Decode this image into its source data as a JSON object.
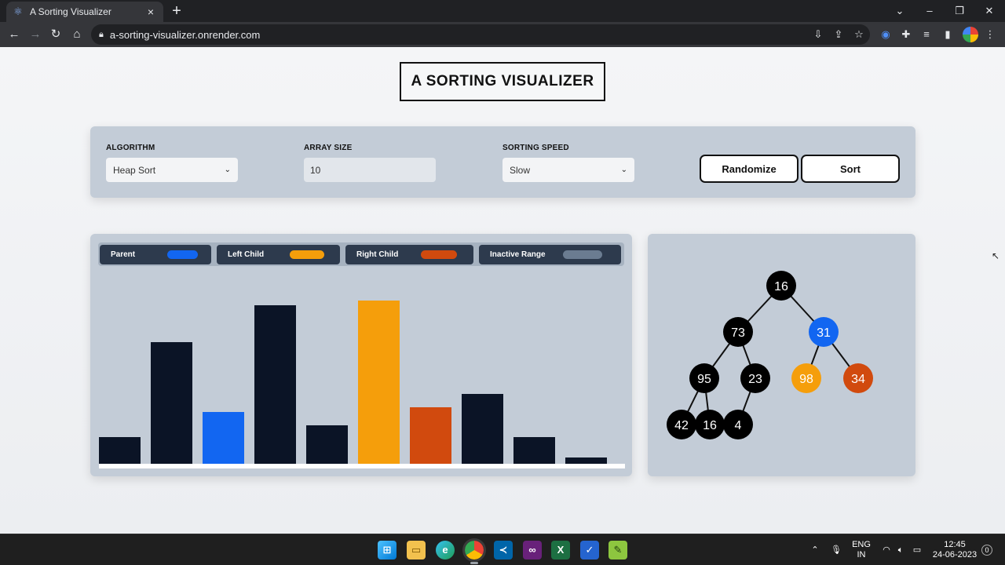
{
  "browser": {
    "tab_title": "A Sorting Visualizer",
    "tab_close": "×",
    "new_tab": "+",
    "url": "a-sorting-visualizer.onrender.com"
  },
  "page": {
    "title": "A SORTING VISUALIZER"
  },
  "controls": {
    "algorithm_label": "ALGORITHM",
    "algorithm_value": "Heap Sort",
    "array_size_label": "ARRAY SIZE",
    "array_size_value": "10",
    "speed_label": "SORTING SPEED",
    "speed_value": "Slow",
    "randomize_label": "Randomize",
    "sort_label": "Sort"
  },
  "legend": [
    {
      "label": "Parent",
      "color": "#1266f1"
    },
    {
      "label": "Left Child",
      "color": "#f59e0b"
    },
    {
      "label": "Right Child",
      "color": "#d14a0e"
    },
    {
      "label": "Inactive Range",
      "color": "#6b7c91"
    }
  ],
  "colors": {
    "bar_default": "#0b1426",
    "parent": "#1266f1",
    "left_child": "#f59e0b",
    "right_child": "#d14a0e",
    "node_default": "#000000"
  },
  "bars": [
    {
      "value": 16,
      "state": "default"
    },
    {
      "value": 73,
      "state": "default"
    },
    {
      "value": 31,
      "state": "parent"
    },
    {
      "value": 95,
      "state": "default"
    },
    {
      "value": 23,
      "state": "default"
    },
    {
      "value": 98,
      "state": "left_child"
    },
    {
      "value": 34,
      "state": "right_child"
    },
    {
      "value": 42,
      "state": "default"
    },
    {
      "value": 16,
      "state": "default"
    },
    {
      "value": 4,
      "state": "default"
    }
  ],
  "tree": {
    "nodes": [
      {
        "label": "16",
        "state": "default"
      },
      {
        "label": "73",
        "state": "default"
      },
      {
        "label": "31",
        "state": "parent"
      },
      {
        "label": "95",
        "state": "default"
      },
      {
        "label": "23",
        "state": "default"
      },
      {
        "label": "98",
        "state": "left_child"
      },
      {
        "label": "34",
        "state": "right_child"
      },
      {
        "label": "42",
        "state": "default"
      },
      {
        "label": "16",
        "state": "default"
      },
      {
        "label": "4",
        "state": "default"
      }
    ]
  },
  "taskbar": {
    "language_top": "ENG",
    "language_bottom": "IN",
    "time": "12:45",
    "date": "24-06-2023",
    "notification_count": "0"
  }
}
